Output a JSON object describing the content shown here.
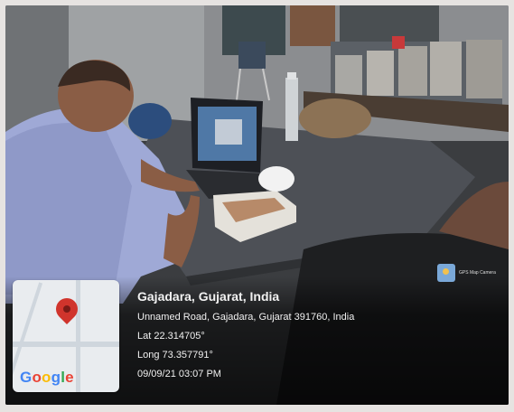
{
  "location": {
    "place": "Gajadara, Gujarat, India",
    "address": "Unnamed Road, Gajadara, Gujarat 391760, India",
    "latitude": "Lat 22.314705°",
    "longitude": "Long 73.357791°",
    "datetime": "09/09/21 03:07 PM"
  },
  "map": {
    "logo_letters": [
      "G",
      "o",
      "o",
      "g",
      "l",
      "e"
    ],
    "pin_color": "#d0342c"
  },
  "badge": {
    "text": "GPS Map Camera",
    "icon": "gps-map-camera-app-icon"
  }
}
